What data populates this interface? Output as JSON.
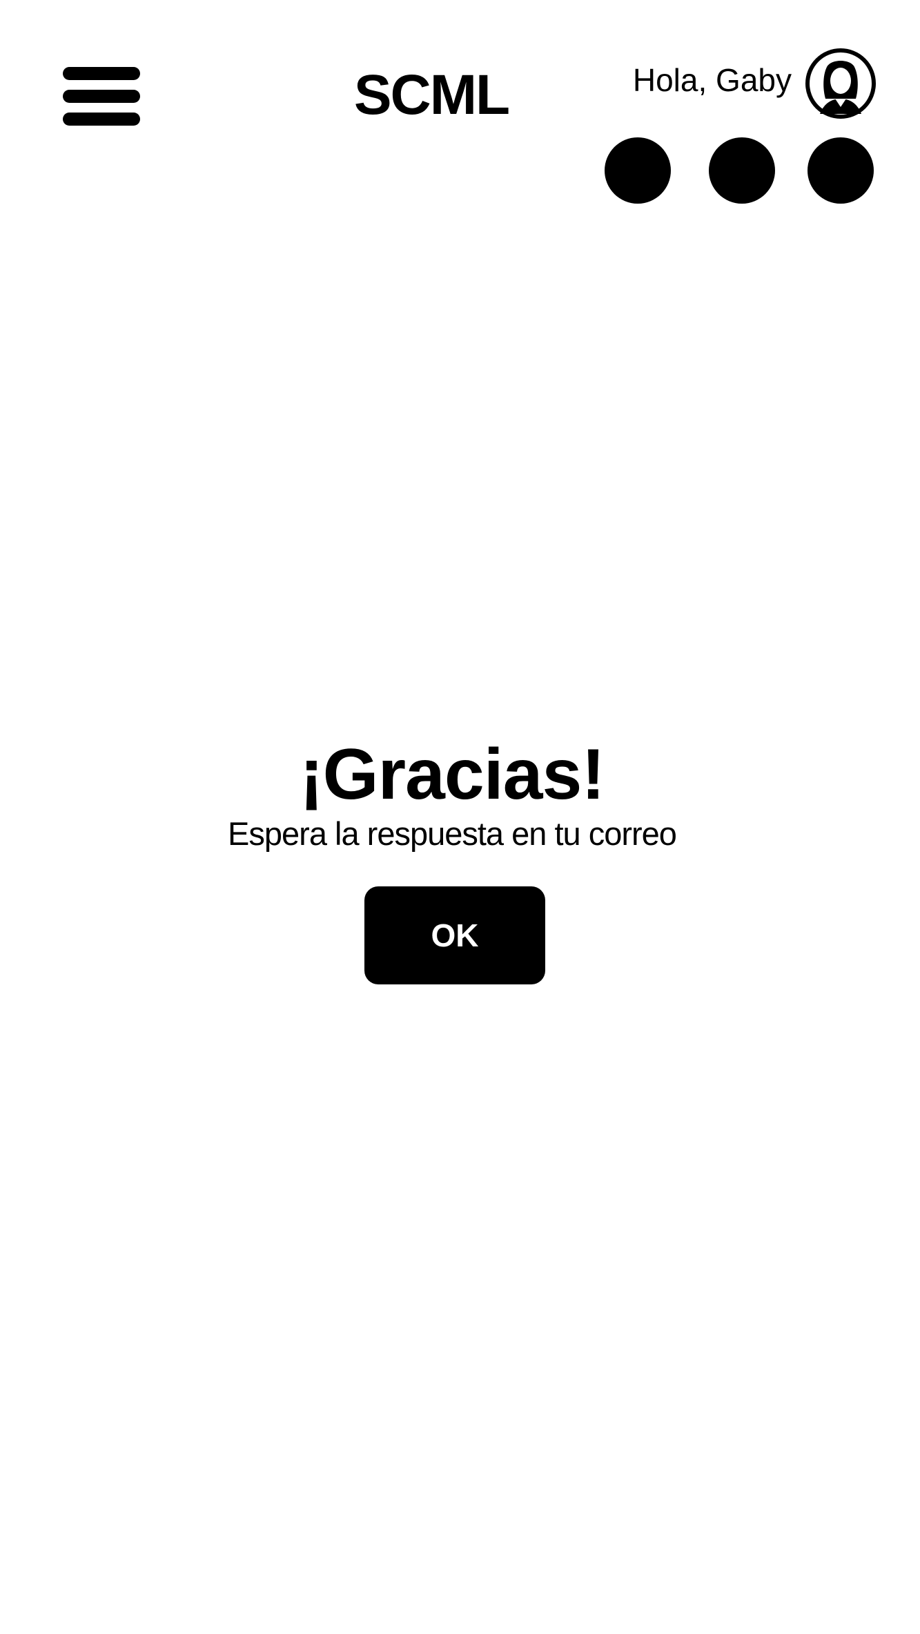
{
  "header": {
    "menu_icon": "hamburger-menu-icon",
    "brand": "SCML",
    "greeting": "Hola, Gaby",
    "avatar_icon": "user-avatar-icon",
    "dots": [
      "dot",
      "dot",
      "dot"
    ]
  },
  "dialog": {
    "title": "¡Gracias!",
    "message": "Espera la respuesta en tu correo",
    "ok_label": "OK"
  },
  "colors": {
    "foreground": "#000000",
    "background": "#ffffff",
    "button_text": "#ffffff"
  }
}
